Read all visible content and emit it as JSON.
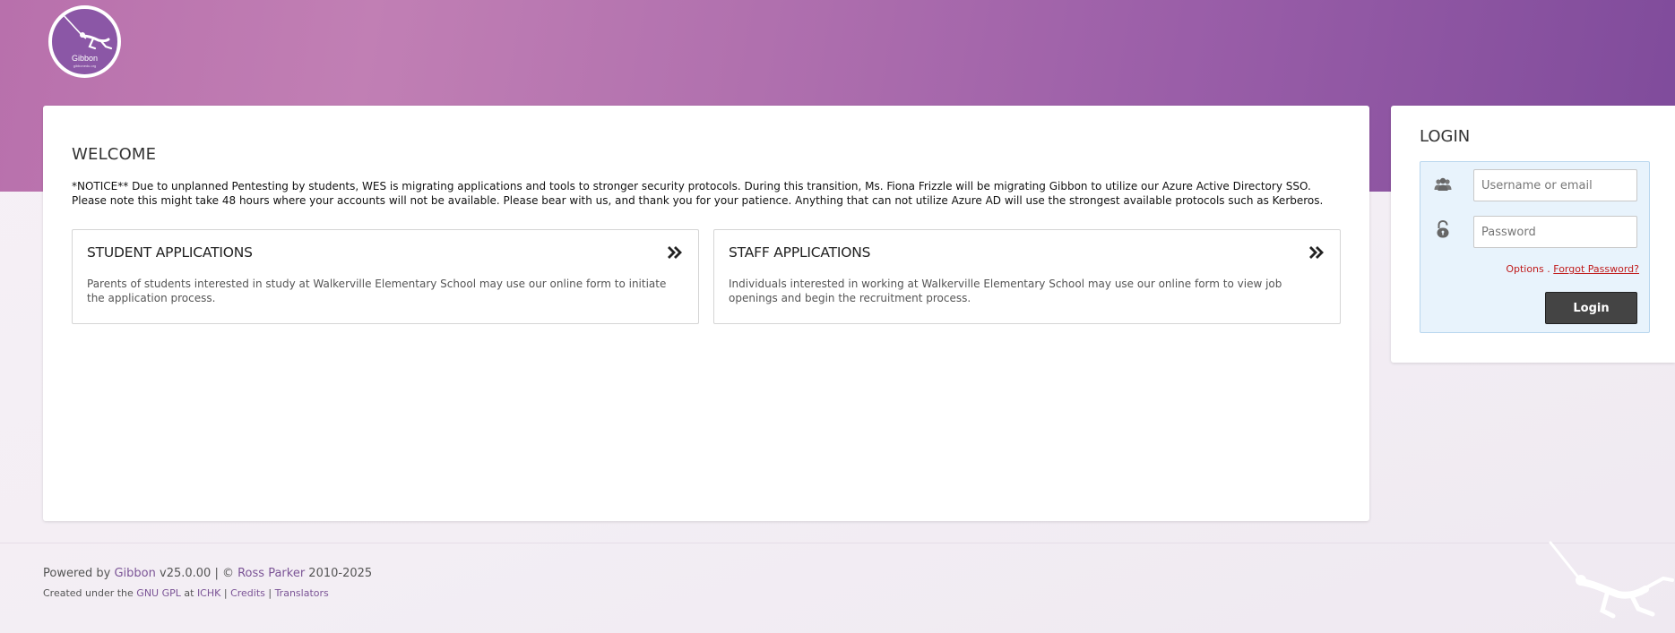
{
  "header": {
    "logo_text": "Gibbon",
    "logo_subtext": "gibbonedu.org",
    "brand_colors": {
      "banner_start": "#b870ac",
      "banner_end": "#7f4b9b"
    }
  },
  "welcome": {
    "title": "WELCOME",
    "notice": "*NOTICE** Due to unplanned Pentesting by students, WES is migrating applications and tools to stronger security protocols. During this transition, Ms. Fiona Frizzle will be migrating Gibbon to utilize our Azure Active Directory SSO. Please note this might take 48 hours where your accounts will not be available. Please bear with us, and thank you for your patience. Anything that can not utilize Azure AD will use the strongest available protocols such as Kerberos."
  },
  "applications": [
    {
      "title": "STUDENT APPLICATIONS",
      "description": "Parents of students interested in study at Walkerville Elementary School may use our online form to initiate the application process.",
      "icon": "double-chevron-right-icon"
    },
    {
      "title": "STAFF APPLICATIONS",
      "description": "Individuals interested in working at Walkerville Elementary School may use our online form to view job openings and begin the recruitment process.",
      "icon": "double-chevron-right-icon"
    }
  ],
  "login": {
    "title": "LOGIN",
    "username_placeholder": "Username or email",
    "password_placeholder": "Password",
    "options_label": "Options",
    "options_separator": " . ",
    "forgot_password": "Forgot Password?",
    "button_label": "Login",
    "user_icon": "users-icon",
    "lock_icon": "lock-icon"
  },
  "footer": {
    "powered_by": "Powered by ",
    "gibbon_link": "Gibbon",
    "version_text": " v25.0.00 | © ",
    "author_link": "Ross Parker",
    "years": " 2010-2025",
    "created_under": "Created under the ",
    "license_link": "GNU GPL",
    "at_text": " at ",
    "ichk_link": "ICHK",
    "sep1": " | ",
    "credits_link": "Credits",
    "sep2": " | ",
    "translators_link": "Translators"
  }
}
